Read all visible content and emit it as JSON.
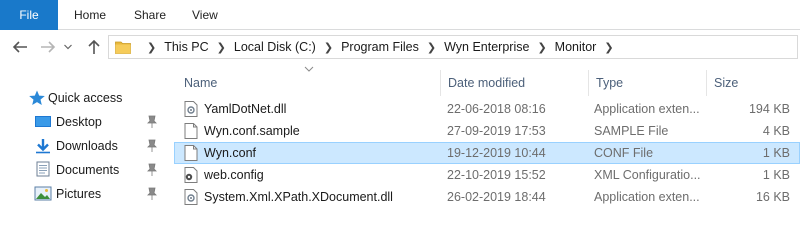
{
  "ribbon": {
    "tabs": [
      {
        "label": "File"
      },
      {
        "label": "Home"
      },
      {
        "label": "Share"
      },
      {
        "label": "View"
      }
    ]
  },
  "address": {
    "crumbs": [
      "This PC",
      "Local Disk (C:)",
      "Program Files",
      "Wyn Enterprise",
      "Monitor"
    ]
  },
  "sidebar": {
    "items": [
      {
        "label": "Quick access",
        "icon": "star-icon"
      },
      {
        "label": "Desktop",
        "icon": "desktop-icon"
      },
      {
        "label": "Downloads",
        "icon": "download-icon"
      },
      {
        "label": "Documents",
        "icon": "documents-icon"
      },
      {
        "label": "Pictures",
        "icon": "pictures-icon"
      }
    ]
  },
  "columns": {
    "name": "Name",
    "date": "Date modified",
    "type": "Type",
    "size": "Size"
  },
  "files": [
    {
      "name": "YamlDotNet.dll",
      "date": "22-06-2018 08:16",
      "type": "Application exten...",
      "size": "194 KB",
      "icon": "dll-file-icon",
      "selected": false
    },
    {
      "name": "Wyn.conf.sample",
      "date": "27-09-2019 17:53",
      "type": "SAMPLE File",
      "size": "4 KB",
      "icon": "blank-file-icon",
      "selected": false
    },
    {
      "name": "Wyn.conf",
      "date": "19-12-2019 10:44",
      "type": "CONF File",
      "size": "1 KB",
      "icon": "blank-file-icon",
      "selected": true
    },
    {
      "name": "web.config",
      "date": "22-10-2019 15:52",
      "type": "XML Configuratio...",
      "size": "1 KB",
      "icon": "config-file-icon",
      "selected": false
    },
    {
      "name": "System.Xml.XPath.XDocument.dll",
      "date": "26-02-2019 18:44",
      "type": "Application exten...",
      "size": "16 KB",
      "icon": "dll-file-icon",
      "selected": false
    }
  ],
  "colors": {
    "accent": "#1979ca",
    "selection": "#cce8ff",
    "selection_border": "#99d1ff",
    "header_text": "#4c607a",
    "folder": "#e8b83c"
  }
}
